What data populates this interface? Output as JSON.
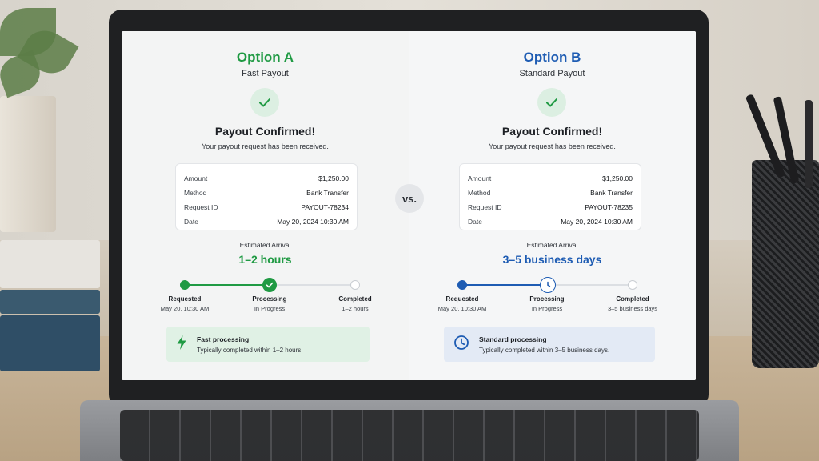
{
  "colors": {
    "green_accent": "#1f9a43",
    "blue_accent": "#1e5cb3",
    "green_note_bg": "#e0f1e5",
    "blue_note_bg": "#e3eaf5"
  },
  "vs_label": "vs.",
  "options": [
    {
      "title": "Option A",
      "subtitle": "Fast Payout",
      "confirm_title": "Payout Confirmed!",
      "confirm_subtitle": "Your payout request has been received.",
      "details": [
        {
          "label": "Amount",
          "value": "$1,250.00"
        },
        {
          "label": "Method",
          "value": "Bank Transfer"
        },
        {
          "label": "Request ID",
          "value": "PAYOUT-78234"
        },
        {
          "label": "Date",
          "value": "May 20, 2024 10:30 AM"
        }
      ],
      "eta_label": "Estimated Arrival",
      "eta_value": "1–2 hours",
      "steps": [
        {
          "name": "Requested",
          "detail": "May 20, 10:30 AM"
        },
        {
          "name": "Processing",
          "detail": "In Progress"
        },
        {
          "name": "Completed",
          "detail": "1–2 hours"
        }
      ],
      "progress": 0.5,
      "note_title": "Fast processing",
      "note_desc": "Typically completed within 1–2 hours.",
      "note_icon": "lightning-icon"
    },
    {
      "title": "Option B",
      "subtitle": "Standard Payout",
      "confirm_title": "Payout Confirmed!",
      "confirm_subtitle": "Your payout request has been received.",
      "details": [
        {
          "label": "Amount",
          "value": "$1,250.00"
        },
        {
          "label": "Method",
          "value": "Bank Transfer"
        },
        {
          "label": "Request ID",
          "value": "PAYOUT-78235"
        },
        {
          "label": "Date",
          "value": "May 20, 2024 10:30 AM"
        }
      ],
      "eta_label": "Estimated Arrival",
      "eta_value": "3–5 business days",
      "steps": [
        {
          "name": "Requested",
          "detail": "May 20, 10:30 AM"
        },
        {
          "name": "Processing",
          "detail": "In Progress"
        },
        {
          "name": "Completed",
          "detail": "3–5 business days"
        }
      ],
      "progress": 0.5,
      "note_title": "Standard processing",
      "note_desc": "Typically completed within 3–5 business days.",
      "note_icon": "clock-icon"
    }
  ]
}
